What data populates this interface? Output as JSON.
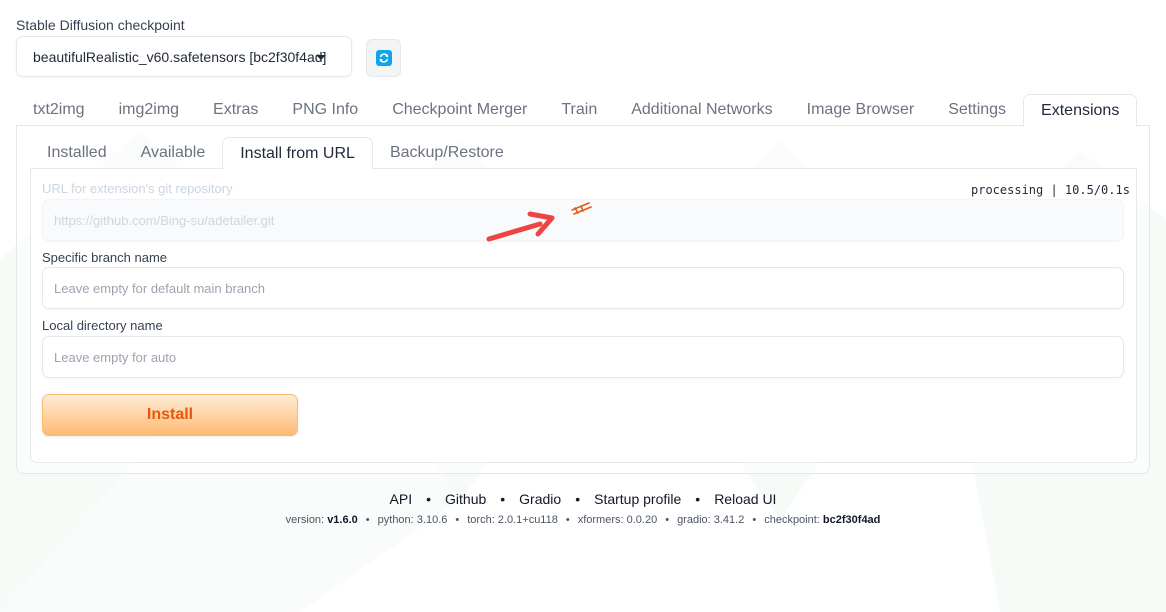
{
  "checkpoint": {
    "label": "Stable Diffusion checkpoint",
    "value": "beautifulRealistic_v60.safetensors [bc2f30f4ad]",
    "refresh_icon": "refresh-icon"
  },
  "top_tabs": [
    "txt2img",
    "img2img",
    "Extras",
    "PNG Info",
    "Checkpoint Merger",
    "Train",
    "Additional Networks",
    "Image Browser",
    "Settings",
    "Extensions"
  ],
  "active_top_tab": "Extensions",
  "sub_tabs": [
    "Installed",
    "Available",
    "Install from URL",
    "Backup/Restore"
  ],
  "active_sub_tab": "Install from URL",
  "form": {
    "url_label": "URL for extension's git repository",
    "url_value": "https://github.com/Bing-su/adetailer.git",
    "branch_label": "Specific branch name",
    "branch_placeholder": "Leave empty for default main branch",
    "dir_label": "Local directory name",
    "dir_placeholder": "Leave empty for auto",
    "install_label": "Install"
  },
  "progress": {
    "text": "processing | 10.5/0.1s"
  },
  "annotation": {
    "arrow_color": "#ef4444",
    "spinner_color": "#ea580c"
  },
  "footer": {
    "links": [
      "API",
      "Github",
      "Gradio",
      "Startup profile",
      "Reload UI"
    ],
    "separator": "•",
    "version_label": "version:",
    "version_value": "v1.6.0",
    "python": "python: 3.10.6",
    "torch": "torch: 2.0.1+cu118",
    "xformers": "xformers: 0.0.20",
    "gradio": "gradio: 3.41.2",
    "checkpoint_label": "checkpoint:",
    "checkpoint_value": "bc2f30f4ad"
  },
  "colors": {
    "accent_orange": "#ea580c",
    "refresh_blue": "#0ea5e9"
  }
}
